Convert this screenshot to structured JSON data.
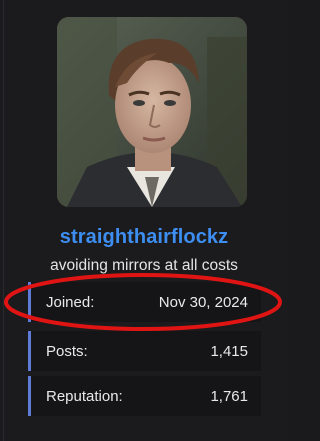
{
  "profile": {
    "username": "straighthairflockz",
    "tagline": "avoiding mirrors at all costs"
  },
  "stats": [
    {
      "label": "Joined:",
      "value": "Nov 30, 2024"
    },
    {
      "label": "Posts:",
      "value": "1,415"
    },
    {
      "label": "Reputation:",
      "value": "1,761"
    }
  ],
  "colors": {
    "username": "#3d8ef0",
    "accent_bar": "#5f7bd8",
    "highlight_circle": "#e11414",
    "background": "#1b1b1d"
  }
}
